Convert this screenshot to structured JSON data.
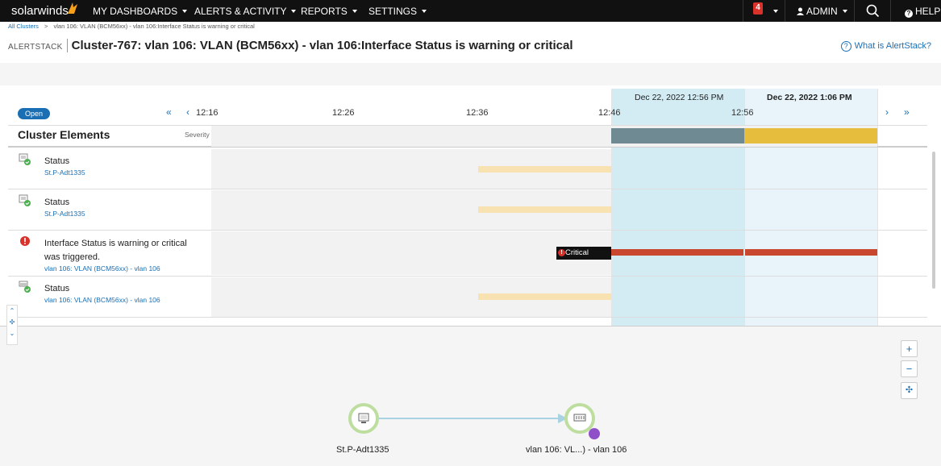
{
  "nav": {
    "brand": "solarwinds",
    "menu": [
      "MY DASHBOARDS",
      "ALERTS & ACTIVITY",
      "REPORTS",
      "SETTINGS"
    ],
    "alert_count": "4",
    "user": "ADMIN",
    "help": "HELP",
    "colors": {
      "bar": "#111111",
      "brand_flame": "#f7a11a",
      "alert": "#d8322b"
    }
  },
  "breadcrumb": {
    "root": "All Clusters",
    "separator": ">",
    "current": "vlan 106: VLAN (BCM56xx) - vlan 106:Interface Status is warning or critical"
  },
  "header": {
    "label": "ALERTSTACK",
    "title": "Cluster-767: vlan 106: VLAN (BCM56xx) - vlan 106:Interface Status is warning or critical",
    "help_link": "What is AlertStack?"
  },
  "timeline": {
    "status_badge": "Open",
    "first_arrow": "«",
    "prev_arrow": "‹",
    "next_arrow": "›",
    "last_arrow": "»",
    "ticks": [
      "12:16",
      "12:26",
      "12:36",
      "12:46",
      "12:56"
    ],
    "highlighted_ranges": [
      "Dec 22, 2022 12:56 PM",
      "Dec 22, 2022 1:06 PM"
    ],
    "elements_header": "Cluster Elements",
    "severity_header": "Severity",
    "critical_label": "Critical",
    "colors": {
      "accent": "#1a6fb4",
      "severity_grey": "#6f8a93",
      "warning": "#e7bd3d",
      "critical": "#c8472e",
      "status_bar": "#f9e2b1"
    }
  },
  "rows": [
    {
      "name": "Status",
      "sub": "St.P-Adt1335",
      "icon": "server-ok-icon"
    },
    {
      "name": "Status",
      "sub": "St.P-Adt1335",
      "icon": "server-ok-icon"
    },
    {
      "name": "Interface Status is warning or critical",
      "name2": "was triggered.",
      "sub": "vlan 106: VLAN (BCM56xx) - vlan 106",
      "icon": "alert-critical-icon"
    },
    {
      "name": "Status",
      "sub": "vlan 106: VLAN (BCM56xx) - vlan 106",
      "icon": "interface-ok-icon"
    }
  ],
  "map": {
    "zoom_in": "+",
    "zoom_out": "−",
    "fit": "✣",
    "nodes": [
      "St.P-Adt1335",
      "vlan 106: VL...) - vlan 106"
    ]
  }
}
